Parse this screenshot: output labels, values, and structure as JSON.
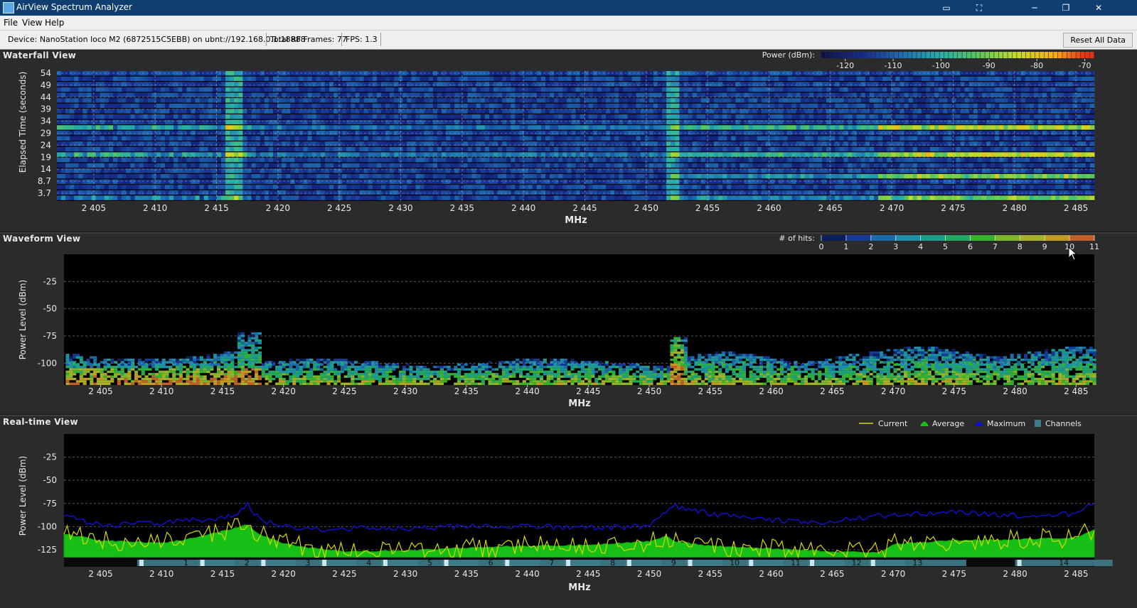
{
  "window": {
    "title": "AirView Spectrum Analyzer",
    "minimize": "─",
    "maximize": "❐",
    "close": "✕"
  },
  "menu": [
    "File",
    "View",
    "Help"
  ],
  "status": {
    "device": "Device: NanoStation loco M2 (6872515C5EBB) on ubnt://192.168.0.1:18888",
    "frames": "Total RF Frames: 77",
    "fps": "FPS: 1.3",
    "reset": "Reset All Data"
  },
  "waterfall": {
    "title": "Waterfall View",
    "ylabel": "Elapsed Time (seconds)",
    "xlabel": "MHz",
    "yticks": [
      "54",
      "49",
      "44",
      "39",
      "34",
      "29",
      "24",
      "19",
      "14",
      "8.7",
      "3.7"
    ],
    "power_label": "Power (dBm):",
    "power_ticks": [
      "-120",
      "-110",
      "-100",
      "-90",
      "-80",
      "-70"
    ]
  },
  "waveform": {
    "title": "Waveform View",
    "ylabel": "Power Level (dBm)",
    "xlabel": "MHz",
    "yticks": [
      "-25",
      "-50",
      "-75",
      "-100"
    ],
    "hits_label": "# of hits:",
    "hits_ticks": [
      "0",
      "1",
      "2",
      "3",
      "4",
      "5",
      "6",
      "7",
      "8",
      "9",
      "10",
      "11"
    ]
  },
  "realtime": {
    "title": "Real-time View",
    "ylabel": "Power Level (dBm)",
    "xlabel": "MHz",
    "yticks": [
      "-25",
      "-50",
      "-75",
      "-100",
      "-125"
    ],
    "legend": [
      {
        "label": "Current",
        "color": "#d8d800"
      },
      {
        "label": "Average",
        "color": "#16c016"
      },
      {
        "label": "Maximum",
        "color": "#1010c8"
      },
      {
        "label": "Channels",
        "color": "#3f7b88"
      }
    ],
    "channels": [
      "1",
      "2",
      "3",
      "4",
      "5",
      "6",
      "7",
      "8",
      "9",
      "10",
      "11",
      "12",
      "13",
      "14"
    ]
  },
  "freq_ticks": [
    "2 405",
    "2 410",
    "2 415",
    "2 420",
    "2 425",
    "2 430",
    "2 435",
    "2 440",
    "2 445",
    "2 450",
    "2 455",
    "2 460",
    "2 465",
    "2 470",
    "2 475",
    "2 480",
    "2 485"
  ],
  "colors": {
    "average": "#16c016",
    "current": "#d8d800",
    "maximum": "#1010c8",
    "channel": "#3f7b88",
    "background": "#000000",
    "panel": "#2b2b2b",
    "titlebar": "#0f3e70"
  },
  "chart_data": [
    {
      "type": "heatmap",
      "title": "Waterfall View",
      "xlabel": "MHz",
      "ylabel": "Elapsed Time (seconds)",
      "xlim": [
        2402,
        2486.5
      ],
      "y_ticks": [
        54,
        49,
        44,
        39,
        34,
        29,
        24,
        19,
        14,
        8.7,
        3.7
      ],
      "colorbar": {
        "label": "Power (dBm):",
        "range": [
          -125,
          -68
        ],
        "ticks": [
          -120,
          -110,
          -100,
          -90,
          -80,
          -70
        ]
      }
    },
    {
      "type": "heatmap",
      "title": "Waveform View",
      "xlabel": "MHz",
      "ylabel": "Power Level (dBm)",
      "xlim": [
        2402,
        2486.5
      ],
      "ylim": [
        -120,
        0
      ],
      "colorbar": {
        "label": "# of hits:",
        "range": [
          0,
          11
        ]
      }
    },
    {
      "type": "area",
      "title": "Real-time View",
      "xlabel": "MHz",
      "ylabel": "Power Level (dBm)",
      "xlim": [
        2402,
        2486.5
      ],
      "ylim": [
        -135,
        0
      ],
      "x": [
        2402,
        2405,
        2410,
        2412,
        2414,
        2416,
        2417,
        2418,
        2420,
        2422,
        2425,
        2430,
        2435,
        2440,
        2445,
        2450,
        2451.5,
        2452,
        2455,
        2460,
        2465,
        2469,
        2470,
        2475,
        2480,
        2485,
        2486.5
      ],
      "series": [
        {
          "name": "Average",
          "values": [
            -108,
            -115,
            -118,
            -114,
            -108,
            -102,
            -98,
            -108,
            -118,
            -123,
            -127,
            -126,
            -123,
            -121,
            -120,
            -116,
            -110,
            -116,
            -121,
            -124,
            -127,
            -128,
            -119,
            -115,
            -114,
            -112,
            -103
          ]
        },
        {
          "name": "Maximum",
          "values": [
            -88,
            -99,
            -96,
            -93,
            -92,
            -89,
            -75,
            -92,
            -100,
            -103,
            -102,
            -102,
            -100,
            -100,
            -101,
            -100,
            -84,
            -78,
            -86,
            -93,
            -95,
            -88,
            -87,
            -85,
            -88,
            -86,
            -75
          ]
        }
      ],
      "channels": [
        "1",
        "2",
        "3",
        "4",
        "5",
        "6",
        "7",
        "8",
        "9",
        "10",
        "11",
        "12",
        "13",
        "14"
      ]
    }
  ]
}
